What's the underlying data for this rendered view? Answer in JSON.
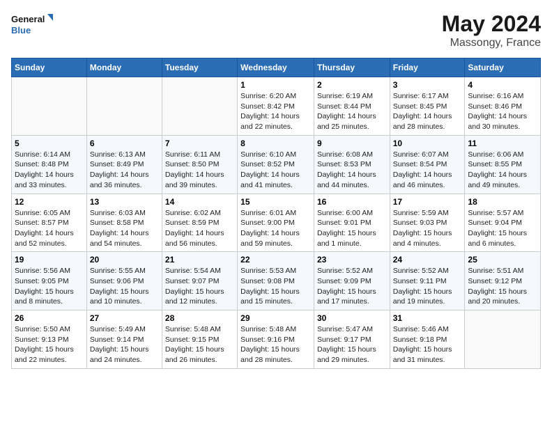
{
  "logo": {
    "line1": "General",
    "line2": "Blue"
  },
  "title": "May 2024",
  "location": "Massongy, France",
  "weekdays": [
    "Sunday",
    "Monday",
    "Tuesday",
    "Wednesday",
    "Thursday",
    "Friday",
    "Saturday"
  ],
  "weeks": [
    [
      {
        "day": "",
        "content": ""
      },
      {
        "day": "",
        "content": ""
      },
      {
        "day": "",
        "content": ""
      },
      {
        "day": "1",
        "content": "Sunrise: 6:20 AM\nSunset: 8:42 PM\nDaylight: 14 hours\nand 22 minutes."
      },
      {
        "day": "2",
        "content": "Sunrise: 6:19 AM\nSunset: 8:44 PM\nDaylight: 14 hours\nand 25 minutes."
      },
      {
        "day": "3",
        "content": "Sunrise: 6:17 AM\nSunset: 8:45 PM\nDaylight: 14 hours\nand 28 minutes."
      },
      {
        "day": "4",
        "content": "Sunrise: 6:16 AM\nSunset: 8:46 PM\nDaylight: 14 hours\nand 30 minutes."
      }
    ],
    [
      {
        "day": "5",
        "content": "Sunrise: 6:14 AM\nSunset: 8:48 PM\nDaylight: 14 hours\nand 33 minutes."
      },
      {
        "day": "6",
        "content": "Sunrise: 6:13 AM\nSunset: 8:49 PM\nDaylight: 14 hours\nand 36 minutes."
      },
      {
        "day": "7",
        "content": "Sunrise: 6:11 AM\nSunset: 8:50 PM\nDaylight: 14 hours\nand 39 minutes."
      },
      {
        "day": "8",
        "content": "Sunrise: 6:10 AM\nSunset: 8:52 PM\nDaylight: 14 hours\nand 41 minutes."
      },
      {
        "day": "9",
        "content": "Sunrise: 6:08 AM\nSunset: 8:53 PM\nDaylight: 14 hours\nand 44 minutes."
      },
      {
        "day": "10",
        "content": "Sunrise: 6:07 AM\nSunset: 8:54 PM\nDaylight: 14 hours\nand 46 minutes."
      },
      {
        "day": "11",
        "content": "Sunrise: 6:06 AM\nSunset: 8:55 PM\nDaylight: 14 hours\nand 49 minutes."
      }
    ],
    [
      {
        "day": "12",
        "content": "Sunrise: 6:05 AM\nSunset: 8:57 PM\nDaylight: 14 hours\nand 52 minutes."
      },
      {
        "day": "13",
        "content": "Sunrise: 6:03 AM\nSunset: 8:58 PM\nDaylight: 14 hours\nand 54 minutes."
      },
      {
        "day": "14",
        "content": "Sunrise: 6:02 AM\nSunset: 8:59 PM\nDaylight: 14 hours\nand 56 minutes."
      },
      {
        "day": "15",
        "content": "Sunrise: 6:01 AM\nSunset: 9:00 PM\nDaylight: 14 hours\nand 59 minutes."
      },
      {
        "day": "16",
        "content": "Sunrise: 6:00 AM\nSunset: 9:01 PM\nDaylight: 15 hours\nand 1 minute."
      },
      {
        "day": "17",
        "content": "Sunrise: 5:59 AM\nSunset: 9:03 PM\nDaylight: 15 hours\nand 4 minutes."
      },
      {
        "day": "18",
        "content": "Sunrise: 5:57 AM\nSunset: 9:04 PM\nDaylight: 15 hours\nand 6 minutes."
      }
    ],
    [
      {
        "day": "19",
        "content": "Sunrise: 5:56 AM\nSunset: 9:05 PM\nDaylight: 15 hours\nand 8 minutes."
      },
      {
        "day": "20",
        "content": "Sunrise: 5:55 AM\nSunset: 9:06 PM\nDaylight: 15 hours\nand 10 minutes."
      },
      {
        "day": "21",
        "content": "Sunrise: 5:54 AM\nSunset: 9:07 PM\nDaylight: 15 hours\nand 12 minutes."
      },
      {
        "day": "22",
        "content": "Sunrise: 5:53 AM\nSunset: 9:08 PM\nDaylight: 15 hours\nand 15 minutes."
      },
      {
        "day": "23",
        "content": "Sunrise: 5:52 AM\nSunset: 9:09 PM\nDaylight: 15 hours\nand 17 minutes."
      },
      {
        "day": "24",
        "content": "Sunrise: 5:52 AM\nSunset: 9:11 PM\nDaylight: 15 hours\nand 19 minutes."
      },
      {
        "day": "25",
        "content": "Sunrise: 5:51 AM\nSunset: 9:12 PM\nDaylight: 15 hours\nand 20 minutes."
      }
    ],
    [
      {
        "day": "26",
        "content": "Sunrise: 5:50 AM\nSunset: 9:13 PM\nDaylight: 15 hours\nand 22 minutes."
      },
      {
        "day": "27",
        "content": "Sunrise: 5:49 AM\nSunset: 9:14 PM\nDaylight: 15 hours\nand 24 minutes."
      },
      {
        "day": "28",
        "content": "Sunrise: 5:48 AM\nSunset: 9:15 PM\nDaylight: 15 hours\nand 26 minutes."
      },
      {
        "day": "29",
        "content": "Sunrise: 5:48 AM\nSunset: 9:16 PM\nDaylight: 15 hours\nand 28 minutes."
      },
      {
        "day": "30",
        "content": "Sunrise: 5:47 AM\nSunset: 9:17 PM\nDaylight: 15 hours\nand 29 minutes."
      },
      {
        "day": "31",
        "content": "Sunrise: 5:46 AM\nSunset: 9:18 PM\nDaylight: 15 hours\nand 31 minutes."
      },
      {
        "day": "",
        "content": ""
      }
    ]
  ]
}
